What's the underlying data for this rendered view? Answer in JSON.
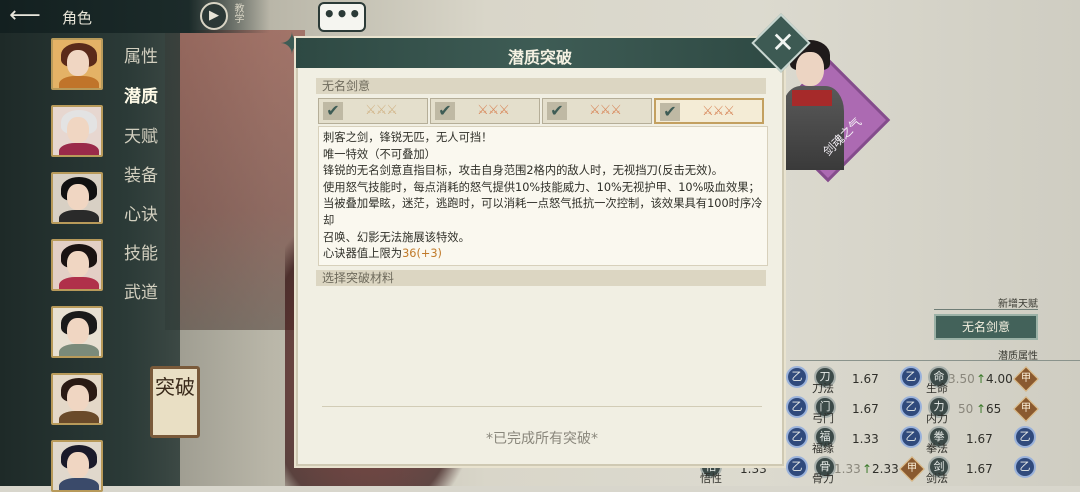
{
  "topbar": {
    "back_icon": "arrow-left-icon",
    "title": "角色",
    "tutorial_label": "教学"
  },
  "sidebar": {
    "menu": [
      {
        "label": "属性",
        "active": false
      },
      {
        "label": "潜质",
        "active": true
      },
      {
        "label": "天赋",
        "active": false
      },
      {
        "label": "装备",
        "active": false
      },
      {
        "label": "心诀",
        "active": false
      },
      {
        "label": "技能",
        "active": false
      },
      {
        "label": "武道",
        "active": false
      }
    ],
    "avatars": [
      "avatar-1",
      "avatar-2",
      "avatar-3",
      "avatar-4",
      "avatar-5",
      "avatar-6",
      "avatar-7"
    ],
    "break_button": "突破"
  },
  "dialog": {
    "title": "潜质突破",
    "talent_section": "无名剑意",
    "slots": [
      {
        "checked": true,
        "active": false
      },
      {
        "checked": true,
        "active": false
      },
      {
        "checked": true,
        "active": false
      },
      {
        "checked": true,
        "active": true
      }
    ],
    "description": {
      "line1": "刺客之剑，锋锐无匹，无人可挡！",
      "line2": "唯一特效（不可叠加）",
      "line3": "锋锐的无名剑意直指目标，攻击自身范围2格内的敌人时，无视挡刀(反击无效)。",
      "line4": "使用怒气技能时，每点消耗的怒气提供10%技能威力、10%无视护甲、10%吸血效果；当被叠加晕眩，迷茫，逃跑时，可以消耗一点怒气抵抗一次控制，该效果具有100时序冷却",
      "line5": "召唤、幻影无法施展该特效。",
      "line6_prefix": "心诀器值上限为",
      "line6_value": "36(+3)"
    },
    "materials_section": "选择突破材料",
    "done_text": "*已完成所有突破*"
  },
  "character": {
    "name": "剑魂之气"
  },
  "right_panel": {
    "new_talent_label": "新增天赋",
    "new_talent_value": "无名剑意",
    "latent_attr_label": "潜质属性",
    "stats": [
      {
        "label": "刀法",
        "value": "1.67"
      },
      {
        "label": "生命",
        "from": "3.50",
        "to": "4.00",
        "grade": "甲"
      },
      {
        "label": "弓门",
        "value": "1.67"
      },
      {
        "label": "内力",
        "from": "50",
        "to": "65",
        "grade": "甲"
      },
      {
        "label": "福缘",
        "value": "1.33"
      },
      {
        "label": "拳法",
        "value": "1.67"
      },
      {
        "label": "悟性",
        "value": "1.33"
      },
      {
        "label": "骨力",
        "from": "1.33",
        "to": "2.33",
        "grade": "甲"
      },
      {
        "label": "剑法",
        "value": "1.67"
      }
    ]
  },
  "chat": {
    "icon": "chat-bubble-icon",
    "text": "•••"
  }
}
